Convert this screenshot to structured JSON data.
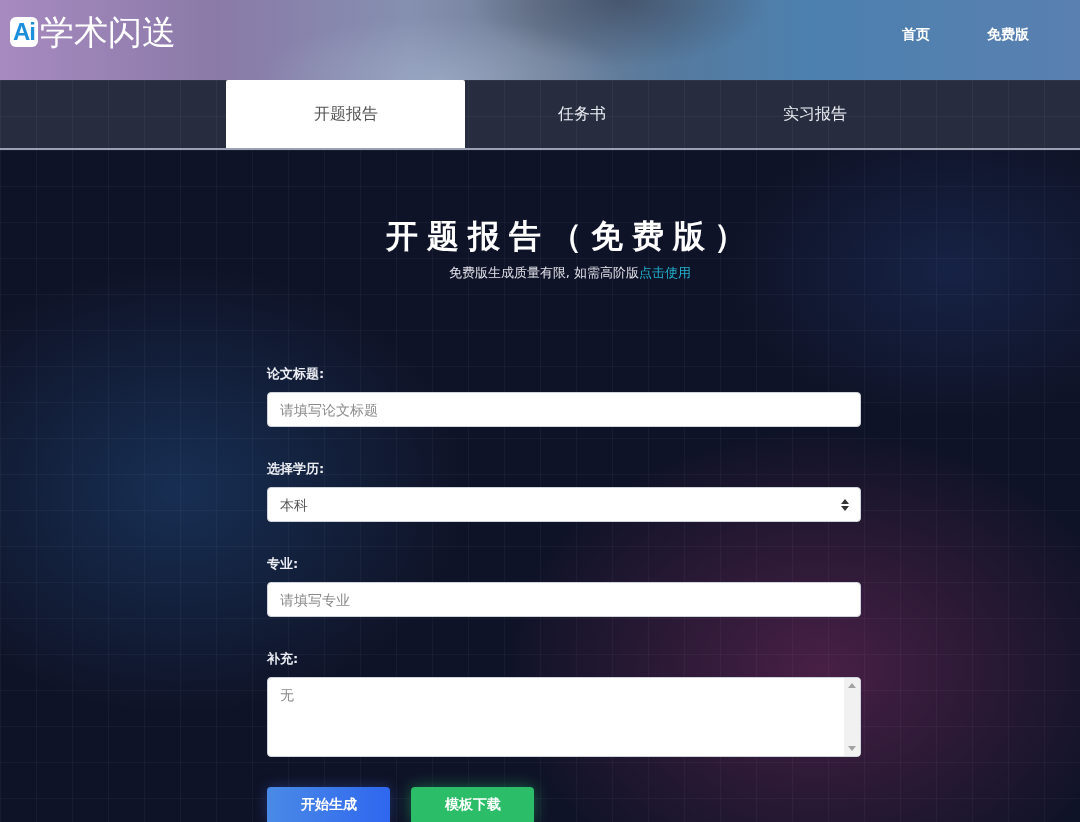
{
  "header": {
    "logo": {
      "mark": "Ai",
      "name": "学术闪送"
    },
    "nav": [
      {
        "label": "首页"
      },
      {
        "label": "免费版"
      }
    ]
  },
  "tabs": [
    {
      "label": "开题报告",
      "selected": true
    },
    {
      "label": "任务书",
      "selected": false
    },
    {
      "label": "实习报告",
      "selected": false
    }
  ],
  "form": {
    "title": "开题报告（免费版）",
    "notice": {
      "text": "免费版生成质量有限, 如需高阶版",
      "link": "点击使用"
    },
    "fields": [
      {
        "kind": "input",
        "label": "论文标题:",
        "placeholder": "请填写论文标题"
      },
      {
        "kind": "select",
        "label": "选择学历:",
        "value": "本科"
      },
      {
        "kind": "input",
        "label": "专业:",
        "placeholder": "请填写专业"
      },
      {
        "kind": "textarea",
        "label": "补充:",
        "placeholder": "无"
      }
    ],
    "buttons": [
      {
        "kind": "primary",
        "label": "开始生成"
      },
      {
        "kind": "success",
        "label": "模板下载"
      }
    ]
  }
}
